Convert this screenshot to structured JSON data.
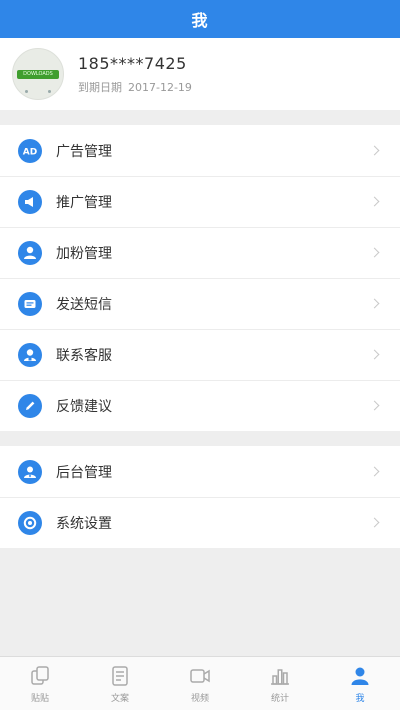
{
  "header": {
    "title": "我"
  },
  "profile": {
    "phone": "185****7425",
    "expire_label": "到期日期",
    "expire_date": "2017-12-19"
  },
  "menu_group_1": [
    {
      "label": "广告管理",
      "icon": "ad-icon"
    },
    {
      "label": "推广管理",
      "icon": "promote-icon"
    },
    {
      "label": "加粉管理",
      "icon": "user-add-icon"
    },
    {
      "label": "发送短信",
      "icon": "sms-icon"
    },
    {
      "label": "联系客服",
      "icon": "customer-service-icon"
    },
    {
      "label": "反馈建议",
      "icon": "edit-icon"
    }
  ],
  "menu_group_2": [
    {
      "label": "后台管理",
      "icon": "admin-icon"
    },
    {
      "label": "系统设置",
      "icon": "settings-icon"
    }
  ],
  "tabs": [
    {
      "label": "贴贴",
      "icon": "copy-icon",
      "active": false
    },
    {
      "label": "文案",
      "icon": "document-icon",
      "active": false
    },
    {
      "label": "视频",
      "icon": "video-icon",
      "active": false
    },
    {
      "label": "统计",
      "icon": "stats-icon",
      "active": false
    },
    {
      "label": "我",
      "icon": "user-icon",
      "active": true
    }
  ],
  "colors": {
    "accent": "#2f86e8",
    "background": "#eeeeee",
    "inactive": "#999999"
  }
}
